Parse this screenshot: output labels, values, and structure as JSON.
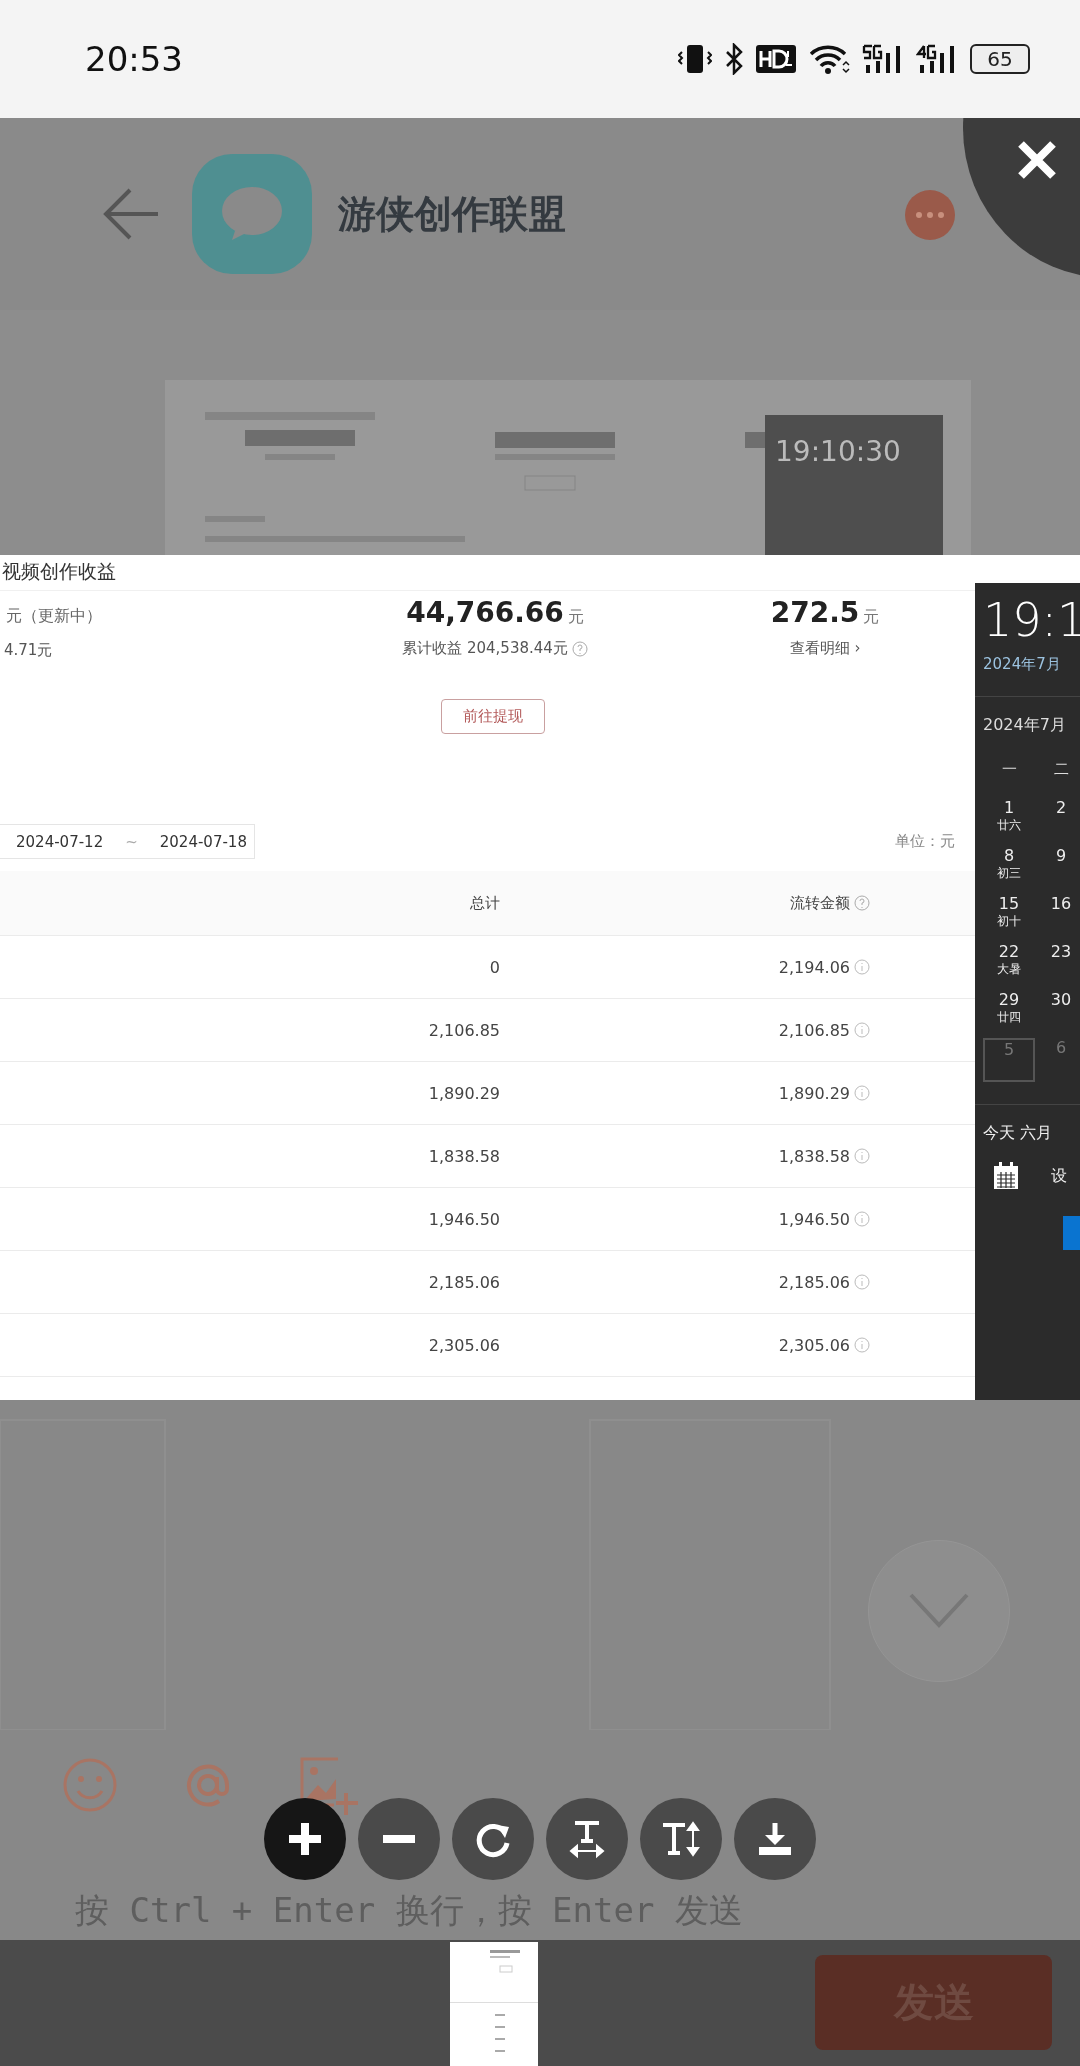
{
  "status_bar": {
    "time": "20:53",
    "battery": "65"
  },
  "chat": {
    "title": "游侠创作联盟",
    "placeholder": "按 Ctrl + Enter 换行，按 Enter 发送",
    "send": "发送"
  },
  "background_shot": {
    "clock": "19:10:30"
  },
  "image": {
    "title": "视频创作收益",
    "left": {
      "unit": "元（更新中）",
      "sub": "4.71元"
    },
    "middle": {
      "value": "44,766.66",
      "unit": "元",
      "sub": "累计收益 204,538.44元"
    },
    "right": {
      "value": "272.5",
      "unit": "元",
      "link": "查看明细 ›"
    },
    "withdraw_button": "前往提现",
    "date_range": {
      "start": "2024-07-12",
      "separator": "~",
      "end": "2024-07-18"
    },
    "unit_label": "单位：元",
    "columns": [
      "总计",
      "流转金额"
    ],
    "rows": [
      {
        "total": "0",
        "flow": "2,194.06"
      },
      {
        "total": "2,106.85",
        "flow": "2,106.85"
      },
      {
        "total": "1,890.29",
        "flow": "1,890.29"
      },
      {
        "total": "1,838.58",
        "flow": "1,838.58"
      },
      {
        "total": "1,946.50",
        "flow": "1,946.50"
      },
      {
        "total": "2,185.06",
        "flow": "2,185.06"
      },
      {
        "total": "2,305.06",
        "flow": "2,305.06"
      }
    ],
    "calendar": {
      "clock": "19:1",
      "date": "2024年7月",
      "month": "2024年7月",
      "weekdays": [
        "一",
        "二"
      ],
      "days": [
        {
          "day": "1",
          "lunar": "廿六",
          "muted": false,
          "highlighted": false
        },
        {
          "day": "2",
          "muted": false,
          "highlighted": false
        },
        {
          "day": "8",
          "lunar": "初三",
          "muted": false,
          "highlighted": false
        },
        {
          "day": "9",
          "muted": false,
          "highlighted": false
        },
        {
          "day": "15",
          "lunar": "初十",
          "muted": false,
          "highlighted": false
        },
        {
          "day": "16",
          "muted": false,
          "highlighted": false
        },
        {
          "day": "22",
          "lunar": "大暑",
          "muted": false,
          "highlighted": false
        },
        {
          "day": "23",
          "muted": false,
          "highlighted": false
        },
        {
          "day": "29",
          "lunar": "廿四",
          "muted": false,
          "highlighted": false
        },
        {
          "day": "30",
          "muted": false,
          "highlighted": false
        },
        {
          "day": "5",
          "muted": true,
          "highlighted": true
        },
        {
          "day": "6",
          "muted": true,
          "highlighted": false
        }
      ],
      "today": "今天 六月",
      "event_hint": "设"
    }
  }
}
